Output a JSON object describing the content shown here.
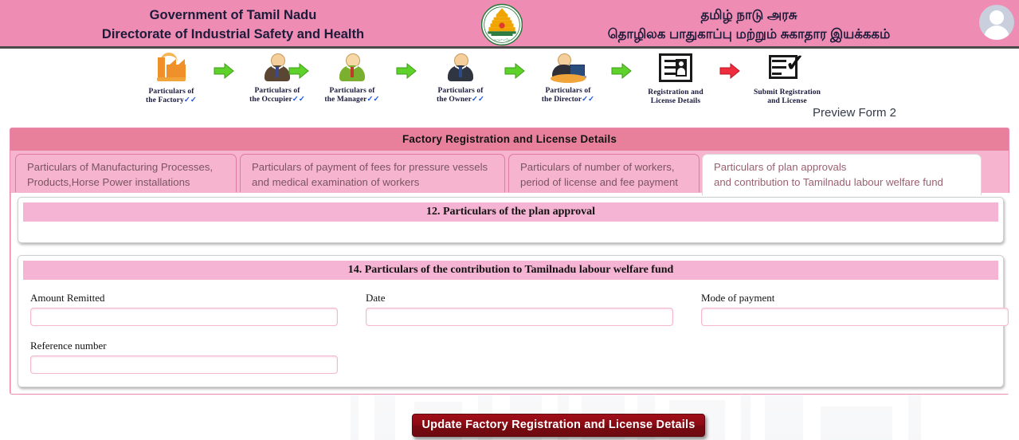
{
  "header": {
    "gov_line1": "Government of Tamil Nadu",
    "gov_line2": "Directorate of Industrial Safety and Health",
    "tamil_line1": "தமிழ் நாடு அரசு",
    "tamil_line2": "தொழிலக பாதுகாப்பு மற்றும் சுகாதார இயக்ககம்",
    "emblem_name": "tamil-nadu-emblem",
    "avatar_name": "user-avatar"
  },
  "stepper": {
    "steps": [
      {
        "line1": "Particulars of",
        "line2": "the Factory",
        "tick": "✓✓",
        "icon": "factory-icon"
      },
      {
        "line1": "Particulars of",
        "line2": "the Occupier",
        "tick": "✓✓",
        "icon": "occupier-icon"
      },
      {
        "line1": "Particulars of",
        "line2": "the Manager",
        "tick": "✓✓",
        "icon": "manager-icon"
      },
      {
        "line1": "Particulars of",
        "line2": "the Owner",
        "tick": "✓✓",
        "icon": "owner-icon"
      },
      {
        "line1": "Particulars of",
        "line2": "the Director",
        "tick": "✓✓",
        "icon": "director-icon"
      },
      {
        "line1": "Registration and",
        "line2": "License Details",
        "tick": "",
        "icon": "registration-card-icon"
      },
      {
        "line1": "Submit Registration",
        "line2": "and License",
        "tick": "",
        "icon": "submit-registration-icon"
      }
    ],
    "arrow_colors": [
      "#5ed12a",
      "#5ed12a",
      "#5ed12a",
      "#5ed12a",
      "#5ed12a",
      "#ef2d3e"
    ]
  },
  "preview_label": "Preview Form 2",
  "panel": {
    "title": "Factory Registration and License Details",
    "tabs": [
      {
        "line1": "Particulars of Manufacturing Processes,",
        "line2": "Products,Horse Power installations",
        "active": false
      },
      {
        "line1": "Particulars of payment of fees for pressure vessels",
        "line2": "and medical examination of workers",
        "active": false
      },
      {
        "line1": "Particulars of number of workers,",
        "line2": "period of license and fee payment",
        "active": false
      },
      {
        "line1": "Particulars of plan approvals",
        "line2": "and contribution to Tamilnadu labour welfare fund",
        "active": true
      }
    ]
  },
  "section_plan": {
    "heading": "12. Particulars of the plan approval"
  },
  "section_welfare": {
    "heading": "14. Particulars of the contribution to Tamilnadu labour welfare fund",
    "fields": [
      {
        "label": "Amount Remitted",
        "value": "",
        "placeholder": ""
      },
      {
        "label": "Date",
        "value": "",
        "placeholder": ""
      },
      {
        "label": "Mode of payment",
        "value": "",
        "placeholder": ""
      },
      {
        "label": "Reference number",
        "value": "",
        "placeholder": ""
      }
    ]
  },
  "submit": {
    "label": "Update Factory Registration and License Details"
  },
  "colors": {
    "header_pink": "#ef8cb4",
    "panel_title_pink": "#e8809c",
    "tab_pink": "#f6b4ce",
    "card_head_pink": "#f6b4d4",
    "input_border_pink": "#f3b8cf",
    "submit_red": "#8c0b14",
    "arrow_green": "#5ed12a",
    "arrow_red": "#ef2d3e"
  }
}
